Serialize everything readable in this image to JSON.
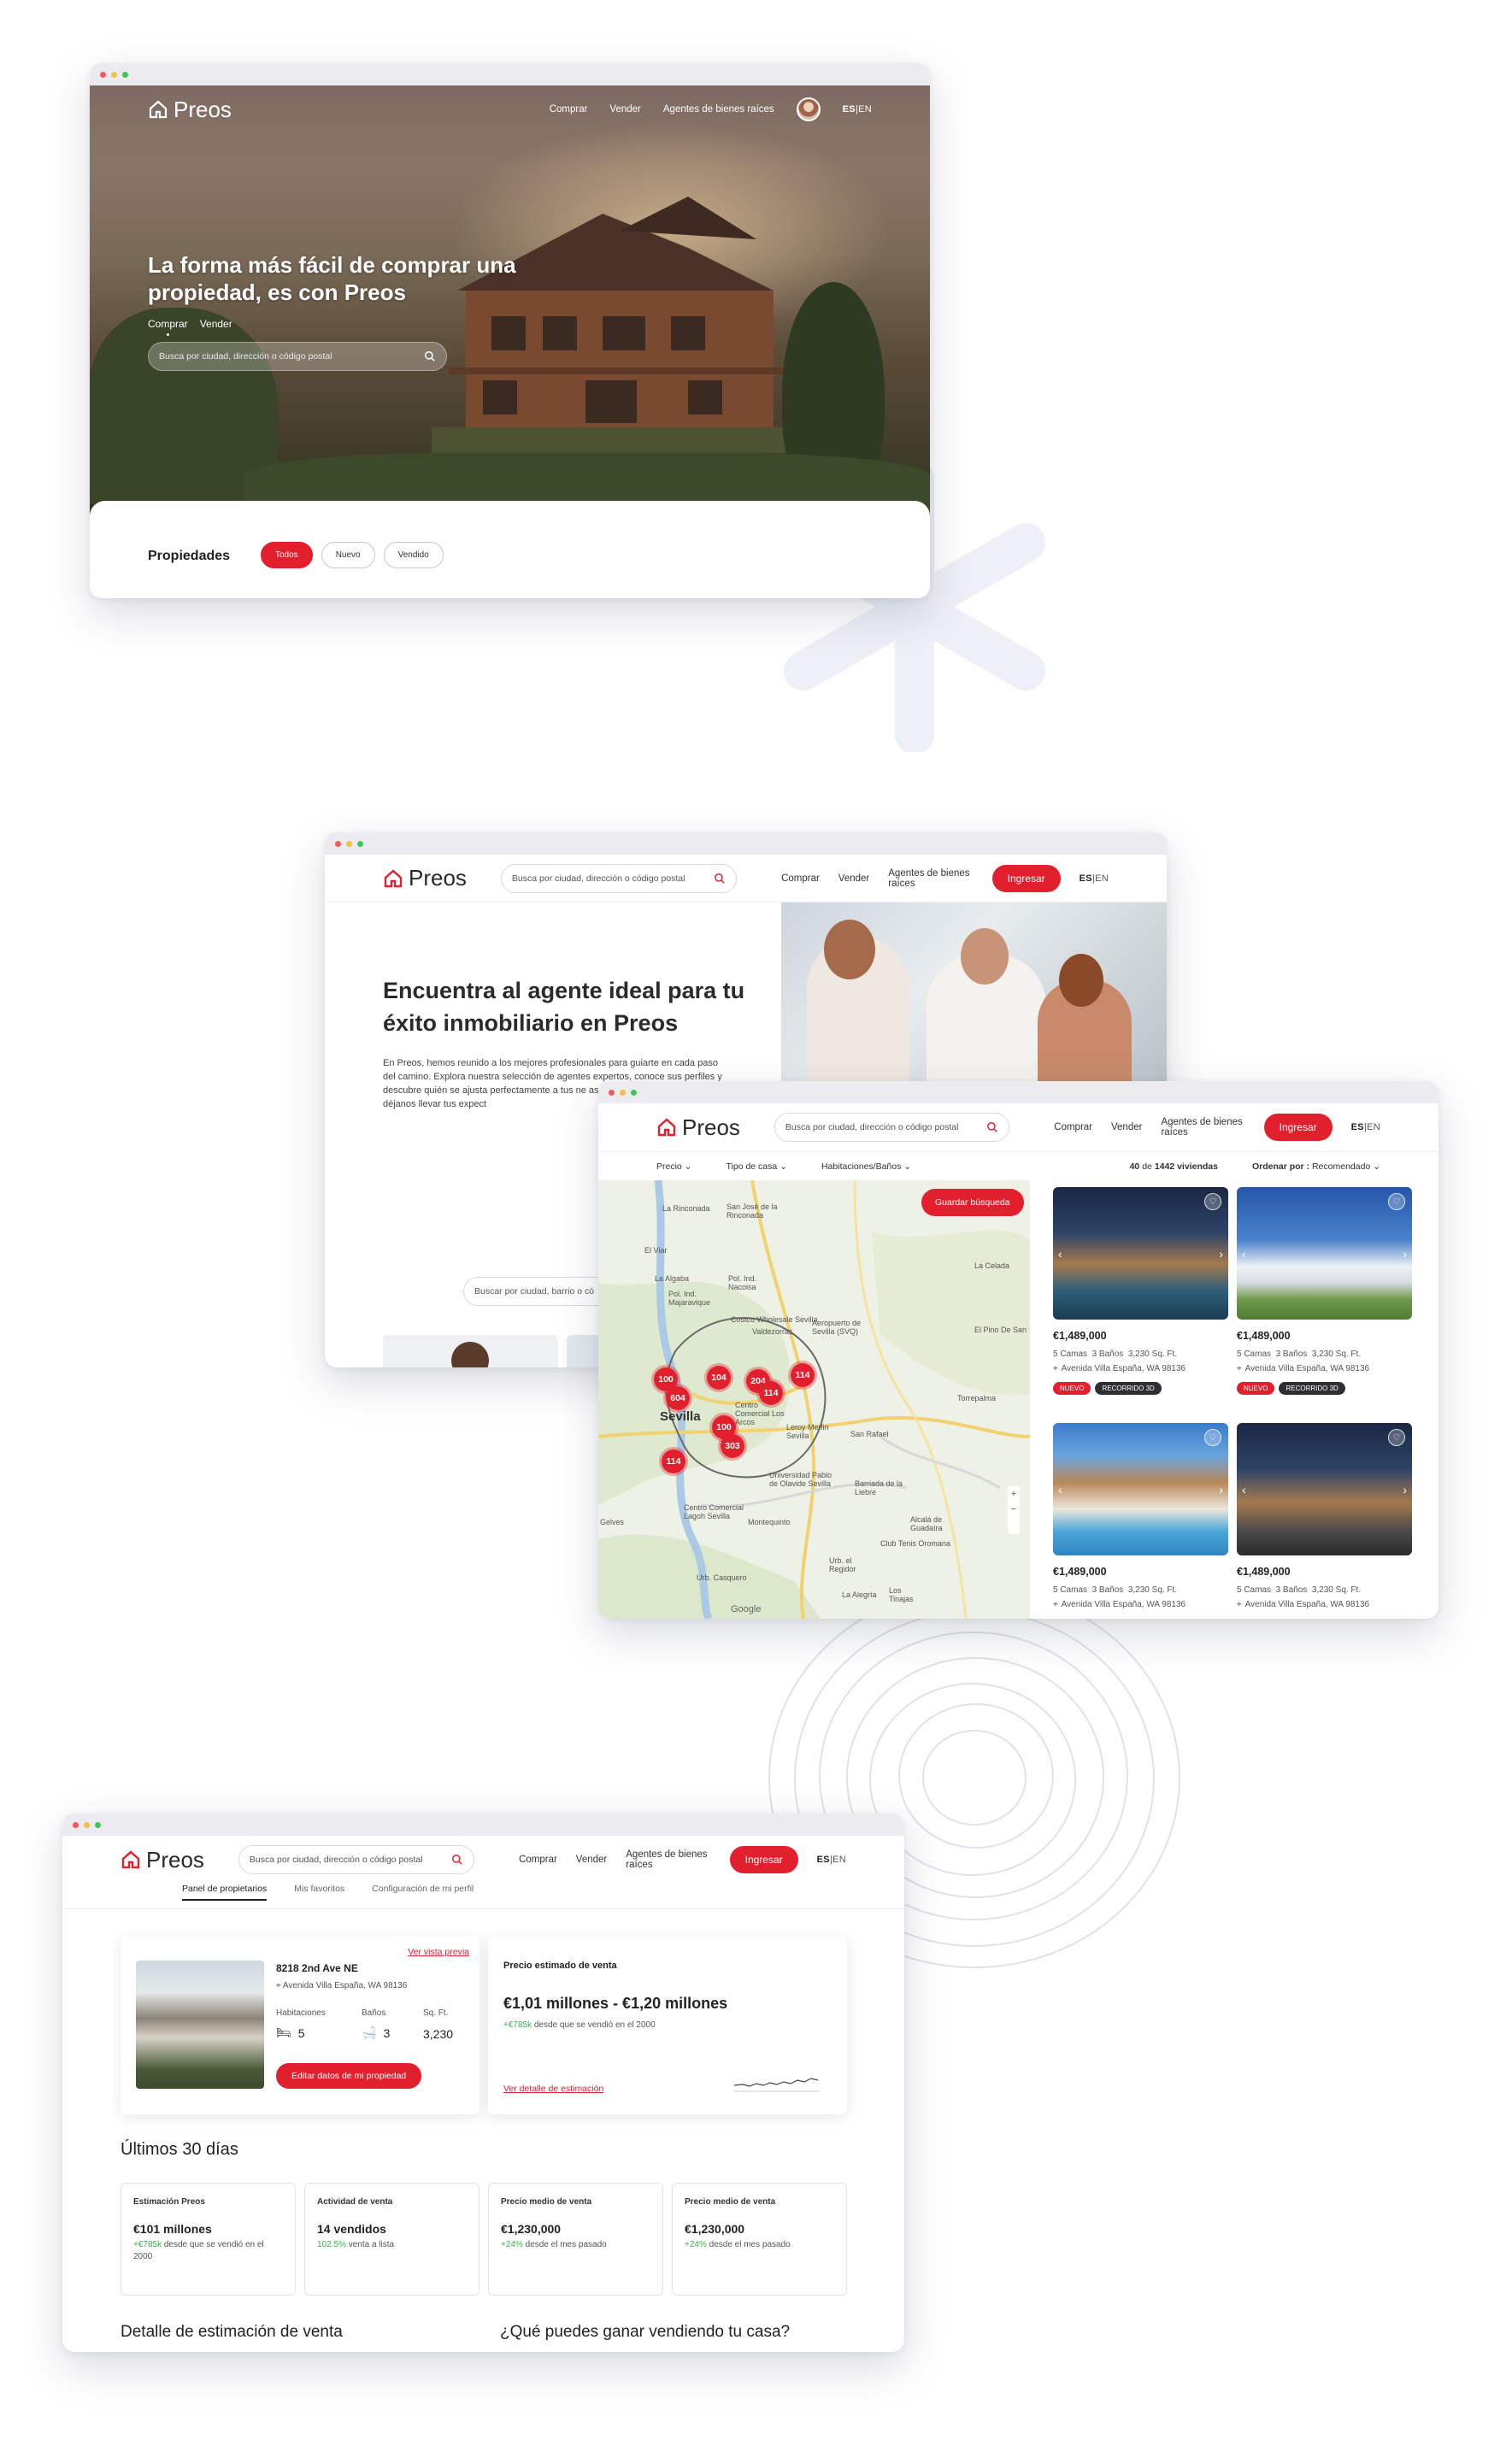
{
  "brand": {
    "name": "Preos",
    "accent": "#e21f2d"
  },
  "nav": {
    "buy": "Comprar",
    "sell": "Vender",
    "agents": "Agentes de bienes raíces",
    "login": "Ingresar",
    "lang_es": "ES",
    "lang_sep": "|",
    "lang_en": "EN"
  },
  "search_placeholder": "Busca por ciudad, dirección o código postal",
  "screen1": {
    "hero_title": "La forma más fácil de comprar una propiedad, es con Preos",
    "tab_buy": "Comprar",
    "tab_sell": "Vender",
    "hero_search": "Busca por ciudad, dirección o código postal",
    "properties_title": "Propiedades",
    "filter_all": "Todos",
    "filter_new": "Nuevo",
    "filter_sold": "Vendido"
  },
  "screen2": {
    "title": "Encuentra al agente ideal para tu éxito inmobiliario en Preos",
    "body": "En Preos, hemos reunido a los mejores profesionales para guiarte en cada paso del camino. Explora nuestra selección de agentes expertos, conoce sus perfiles y descubre quién se ajusta perfectamente a tus ne asesoría personalizada y déjanos llevar tus expect",
    "agent_search": "Buscar por ciudad, barrio o có"
  },
  "screen3": {
    "filter_price": "Precio",
    "filter_type": "Tipo de casa",
    "filter_rooms": "Habitaciones/Baños",
    "results_count": "40",
    "results_of": "de",
    "results_total": "1442 viviendas",
    "sort_label": "Ordenar por :",
    "sort_value": "Recomendado",
    "save_search": "Guardar búsqueda",
    "map_city": "Sevilla",
    "map_labels": [
      "La Rinconada",
      "San José de la Rinconada",
      "El Viar",
      "La Algaba",
      "Pol. Ind. Majaravique",
      "Pol. Ind. Nacoisa",
      "Valdezorras",
      "Costco Wholesale Sevilla",
      "Aeropuerto de Sevilla (SVQ)",
      "El Pino De San",
      "La Celada",
      "Torrepalma",
      "Centro Comercial Los Arcos",
      "Leroy Merlin Sevilla",
      "San Rafael",
      "Universidad Pablo de Olavide Sevilla",
      "Barriada de la Liebre",
      "Montequinto",
      "Alcalá de Guadaíra",
      "Club Tenis Oromana",
      "Gelves",
      "Urb. Casquero",
      "Urb. el Regidor",
      "La Alegría",
      "Los Tinajas",
      "Centro Comercial Lagoh Sevilla",
      "Google"
    ],
    "clusters": [
      "100",
      "604",
      "104",
      "204",
      "114",
      "114",
      "100",
      "303",
      "114"
    ],
    "listings": [
      {
        "price": "€1,489,000",
        "beds": "5 Camas",
        "baths": "3 Baños",
        "sqft": "3,230 Sq. Ft.",
        "address": "Avenida Villa España, WA 98136",
        "tags": [
          "NUEVO",
          "RECORRIDO 3D"
        ]
      },
      {
        "price": "€1,489,000",
        "beds": "5 Camas",
        "baths": "3 Baños",
        "sqft": "3,230 Sq. Ft.",
        "address": "Avenida Villa España, WA 98136",
        "tags": [
          "NUEVO",
          "RECORRIDO 3D"
        ]
      },
      {
        "price": "€1,489,000",
        "beds": "5 Camas",
        "baths": "3 Baños",
        "sqft": "3,230 Sq. Ft.",
        "address": "Avenida Villa España, WA 98136",
        "tags": []
      },
      {
        "price": "€1,489,000",
        "beds": "5 Camas",
        "baths": "3 Baños",
        "sqft": "3,230 Sq. Ft.",
        "address": "Avenida Villa España, WA 98136",
        "tags": []
      }
    ]
  },
  "screen4": {
    "tab_panel": "Panel de propietarios",
    "tab_favs": "Mis favoritos",
    "tab_config": "Configuración de mi perfil",
    "preview_link": "Ver vista previa",
    "address": "8218 2nd Ave NE",
    "location": "Avenida Villa España, WA 98136",
    "rooms_label": "Habitaciones",
    "baths_label": "Baños",
    "sqft_label": "Sq. Ft.",
    "rooms": "5",
    "baths": "3",
    "sqft": "3,230",
    "edit_button": "Editar datos de mi propiedad",
    "estimate_title": "Precio estimado de venta",
    "estimate_value": "€1,01 millones - €1,20 millones",
    "estimate_delta": "+€785k",
    "estimate_delta_text": "desde que se vendió en el 2000",
    "estimate_link": "Ver detalle de estimación",
    "last30_title": "Últimos 30 días",
    "stats": [
      {
        "title": "Estimación Preos",
        "value": "€101 millones",
        "delta": "+€785k",
        "note": "desde que se vendió en el 2000"
      },
      {
        "title": "Actividad de venta",
        "value": "14 vendidos",
        "delta": "102.5%",
        "note": "venta a lista"
      },
      {
        "title": "Precio medio de venta",
        "value": "€1,230,000",
        "delta": "+24%",
        "note": "desde el mes pasado"
      },
      {
        "title": "Precio medio de venta",
        "value": "€1,230,000",
        "delta": "+24%",
        "note": "desde el mes pasado"
      }
    ],
    "detail_title": "Detalle de estimación de venta",
    "earn_title": "¿Qué puedes ganar vendiendo tu casa?"
  }
}
